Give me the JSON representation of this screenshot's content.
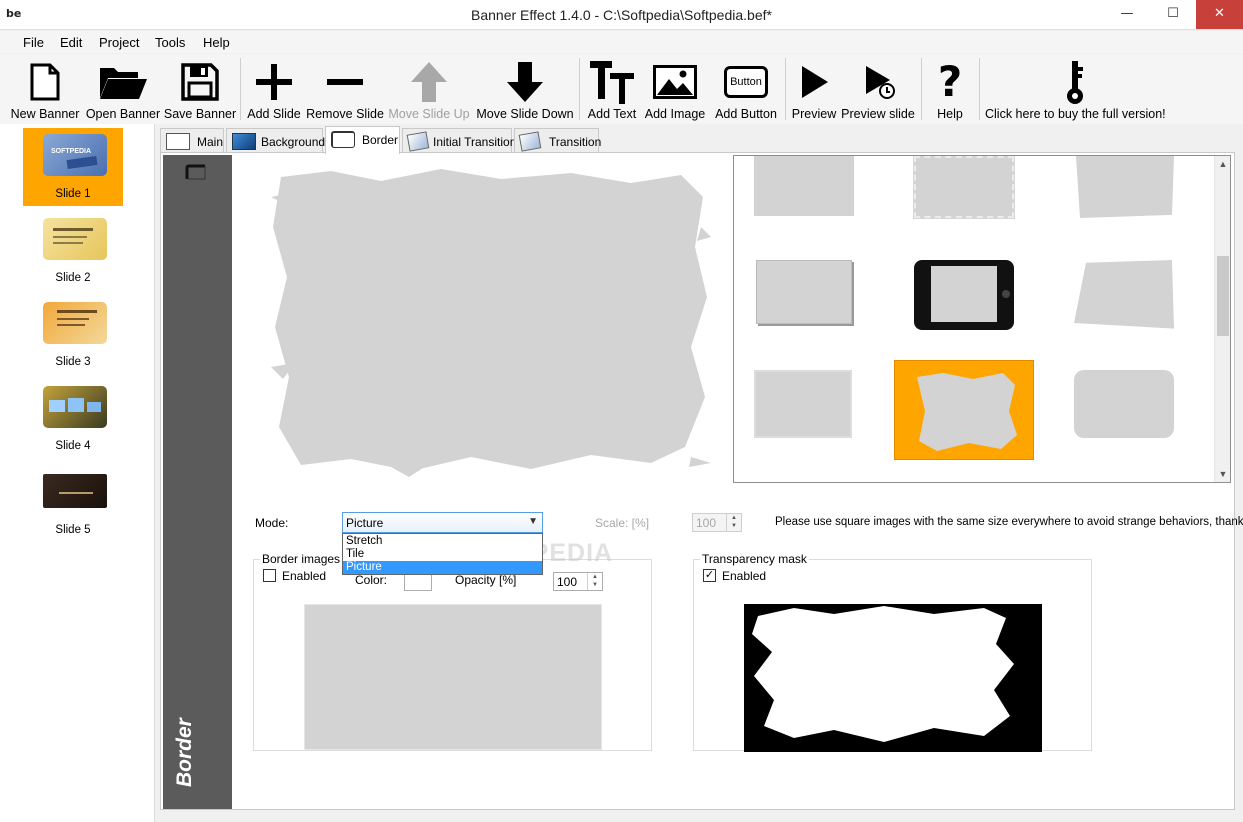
{
  "window": {
    "app_logo": "be",
    "title": "Banner Effect 1.4.0  -  C:\\Softpedia\\Softpedia.bef*",
    "minimize": "—",
    "maximize": "☐",
    "close": "✕"
  },
  "menu": [
    "File",
    "Edit",
    "Project",
    "Tools",
    "Help"
  ],
  "toolbar": {
    "new_banner": "New Banner",
    "open_banner": "Open Banner",
    "save_banner": "Save Banner",
    "add_slide": "Add Slide",
    "remove_slide": "Remove Slide",
    "move_slide_up": "Move Slide Up",
    "move_slide_down": "Move Slide Down",
    "add_text": "Add Text",
    "add_image": "Add Image",
    "add_button": "Add Button",
    "add_button_icon_text": "Button",
    "preview": "Preview",
    "preview_slide": "Preview slide",
    "help": "Help",
    "buy": "Click here to buy the full version!"
  },
  "slides": [
    {
      "label": "Slide 1",
      "selected": true
    },
    {
      "label": "Slide 2",
      "selected": false
    },
    {
      "label": "Slide 3",
      "selected": false
    },
    {
      "label": "Slide 4",
      "selected": false
    },
    {
      "label": "Slide 5",
      "selected": false
    }
  ],
  "slide_thumb_text": {
    "slide1": "SOFTPEDIA"
  },
  "tabs": [
    {
      "label": "Main",
      "active": false
    },
    {
      "label": "Background",
      "active": false
    },
    {
      "label": "Border",
      "active": true
    },
    {
      "label": "Initial Transition",
      "active": false
    },
    {
      "label": "Transition",
      "active": false
    }
  ],
  "border_panel": {
    "side_title": "Border",
    "mode_label": "Mode:",
    "mode_value": "Picture",
    "mode_options": [
      "Stretch",
      "Tile",
      "Picture"
    ],
    "scale_label": "Scale: [%]",
    "scale_value": "100",
    "hint": "Please use square images with the same size everywhere to avoid strange behaviors, thanks!",
    "border_images": {
      "title": "Border images",
      "enabled_label": "Enabled",
      "enabled": false,
      "color_label": "Color:",
      "opacity_label": "Opacity [%]",
      "opacity_value": "100"
    },
    "transparency_mask": {
      "title": "Transparency mask",
      "enabled_label": "Enabled",
      "enabled": true
    },
    "watermark": "SOFTPEDIA"
  },
  "colors": {
    "selection": "#ffa500",
    "side_banner": "#5b5b5b",
    "dropdown_highlight": "#3399ff"
  }
}
